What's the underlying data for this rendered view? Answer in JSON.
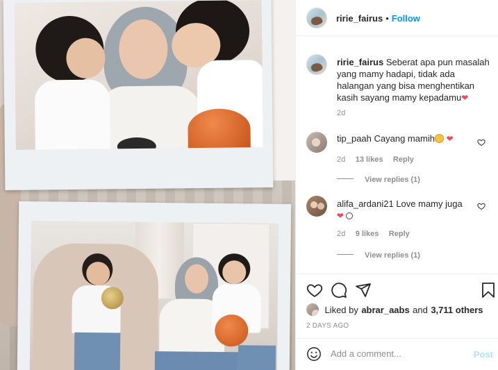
{
  "post_header": {
    "username": "ririe_fairus",
    "separator": "•",
    "follow_label": "Follow"
  },
  "caption": {
    "username": "ririe_fairus",
    "text": "Seberat apa pun masalah yang mamy hadapi, tidak ada halangan yang bisa menghentikan kasih sayang mamy kepadamu",
    "emoji": "heart",
    "time": "2d"
  },
  "comments": [
    {
      "username": "tip_paah",
      "text": "Cayang mamih",
      "emojis": [
        "smiling-face",
        "heart"
      ],
      "time": "2d",
      "likes": "13 likes",
      "reply_label": "Reply",
      "view_replies": "View replies (1)"
    },
    {
      "username": "alifa_ardani21",
      "text": "Love mamy juga",
      "emojis": [
        "heart",
        "smiling-face"
      ],
      "time": "2d",
      "likes": "9 likes",
      "reply_label": "Reply",
      "view_replies": "View replies (1)"
    }
  ],
  "actions": {
    "icons": [
      "heart-icon",
      "comment-icon",
      "share-icon",
      "bookmark-icon"
    ]
  },
  "likes_summary": {
    "prefix": "Liked by",
    "user": "abrar_aabs",
    "middle": "and",
    "count": "3,711 others"
  },
  "timestamp": "2 DAYS AGO",
  "add_comment": {
    "placeholder": "Add a comment...",
    "post_label": "Post"
  },
  "colors": {
    "link_blue": "#0095f6",
    "heart_red": "#ed4956",
    "post_disabled": "#b2dffc",
    "muted_gray": "#8e8e8e"
  }
}
